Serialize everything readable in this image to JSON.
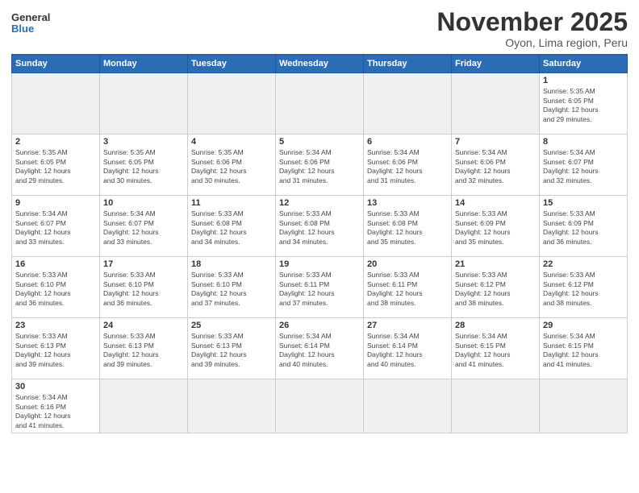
{
  "logo": {
    "line1": "General",
    "line2": "Blue"
  },
  "title": "November 2025",
  "subtitle": "Oyon, Lima region, Peru",
  "weekdays": [
    "Sunday",
    "Monday",
    "Tuesday",
    "Wednesday",
    "Thursday",
    "Friday",
    "Saturday"
  ],
  "weeks": [
    [
      {
        "day": "",
        "empty": true
      },
      {
        "day": "",
        "empty": true
      },
      {
        "day": "",
        "empty": true
      },
      {
        "day": "",
        "empty": true
      },
      {
        "day": "",
        "empty": true
      },
      {
        "day": "",
        "empty": true
      },
      {
        "day": "1",
        "info": "Sunrise: 5:35 AM\nSunset: 6:05 PM\nDaylight: 12 hours\nand 29 minutes."
      }
    ],
    [
      {
        "day": "2",
        "info": "Sunrise: 5:35 AM\nSunset: 6:05 PM\nDaylight: 12 hours\nand 29 minutes."
      },
      {
        "day": "3",
        "info": "Sunrise: 5:35 AM\nSunset: 6:05 PM\nDaylight: 12 hours\nand 30 minutes."
      },
      {
        "day": "4",
        "info": "Sunrise: 5:35 AM\nSunset: 6:06 PM\nDaylight: 12 hours\nand 30 minutes."
      },
      {
        "day": "5",
        "info": "Sunrise: 5:34 AM\nSunset: 6:06 PM\nDaylight: 12 hours\nand 31 minutes."
      },
      {
        "day": "6",
        "info": "Sunrise: 5:34 AM\nSunset: 6:06 PM\nDaylight: 12 hours\nand 31 minutes."
      },
      {
        "day": "7",
        "info": "Sunrise: 5:34 AM\nSunset: 6:06 PM\nDaylight: 12 hours\nand 32 minutes."
      },
      {
        "day": "8",
        "info": "Sunrise: 5:34 AM\nSunset: 6:07 PM\nDaylight: 12 hours\nand 32 minutes."
      }
    ],
    [
      {
        "day": "9",
        "info": "Sunrise: 5:34 AM\nSunset: 6:07 PM\nDaylight: 12 hours\nand 33 minutes."
      },
      {
        "day": "10",
        "info": "Sunrise: 5:34 AM\nSunset: 6:07 PM\nDaylight: 12 hours\nand 33 minutes."
      },
      {
        "day": "11",
        "info": "Sunrise: 5:33 AM\nSunset: 6:08 PM\nDaylight: 12 hours\nand 34 minutes."
      },
      {
        "day": "12",
        "info": "Sunrise: 5:33 AM\nSunset: 6:08 PM\nDaylight: 12 hours\nand 34 minutes."
      },
      {
        "day": "13",
        "info": "Sunrise: 5:33 AM\nSunset: 6:08 PM\nDaylight: 12 hours\nand 35 minutes."
      },
      {
        "day": "14",
        "info": "Sunrise: 5:33 AM\nSunset: 6:09 PM\nDaylight: 12 hours\nand 35 minutes."
      },
      {
        "day": "15",
        "info": "Sunrise: 5:33 AM\nSunset: 6:09 PM\nDaylight: 12 hours\nand 36 minutes."
      }
    ],
    [
      {
        "day": "16",
        "info": "Sunrise: 5:33 AM\nSunset: 6:10 PM\nDaylight: 12 hours\nand 36 minutes."
      },
      {
        "day": "17",
        "info": "Sunrise: 5:33 AM\nSunset: 6:10 PM\nDaylight: 12 hours\nand 36 minutes."
      },
      {
        "day": "18",
        "info": "Sunrise: 5:33 AM\nSunset: 6:10 PM\nDaylight: 12 hours\nand 37 minutes."
      },
      {
        "day": "19",
        "info": "Sunrise: 5:33 AM\nSunset: 6:11 PM\nDaylight: 12 hours\nand 37 minutes."
      },
      {
        "day": "20",
        "info": "Sunrise: 5:33 AM\nSunset: 6:11 PM\nDaylight: 12 hours\nand 38 minutes."
      },
      {
        "day": "21",
        "info": "Sunrise: 5:33 AM\nSunset: 6:12 PM\nDaylight: 12 hours\nand 38 minutes."
      },
      {
        "day": "22",
        "info": "Sunrise: 5:33 AM\nSunset: 6:12 PM\nDaylight: 12 hours\nand 38 minutes."
      }
    ],
    [
      {
        "day": "23",
        "info": "Sunrise: 5:33 AM\nSunset: 6:13 PM\nDaylight: 12 hours\nand 39 minutes."
      },
      {
        "day": "24",
        "info": "Sunrise: 5:33 AM\nSunset: 6:13 PM\nDaylight: 12 hours\nand 39 minutes."
      },
      {
        "day": "25",
        "info": "Sunrise: 5:33 AM\nSunset: 6:13 PM\nDaylight: 12 hours\nand 39 minutes."
      },
      {
        "day": "26",
        "info": "Sunrise: 5:34 AM\nSunset: 6:14 PM\nDaylight: 12 hours\nand 40 minutes."
      },
      {
        "day": "27",
        "info": "Sunrise: 5:34 AM\nSunset: 6:14 PM\nDaylight: 12 hours\nand 40 minutes."
      },
      {
        "day": "28",
        "info": "Sunrise: 5:34 AM\nSunset: 6:15 PM\nDaylight: 12 hours\nand 41 minutes."
      },
      {
        "day": "29",
        "info": "Sunrise: 5:34 AM\nSunset: 6:15 PM\nDaylight: 12 hours\nand 41 minutes."
      }
    ],
    [
      {
        "day": "30",
        "info": "Sunrise: 5:34 AM\nSunset: 6:16 PM\nDaylight: 12 hours\nand 41 minutes."
      },
      {
        "day": "",
        "empty": true
      },
      {
        "day": "",
        "empty": true
      },
      {
        "day": "",
        "empty": true
      },
      {
        "day": "",
        "empty": true
      },
      {
        "day": "",
        "empty": true
      },
      {
        "day": "",
        "empty": true
      }
    ]
  ]
}
